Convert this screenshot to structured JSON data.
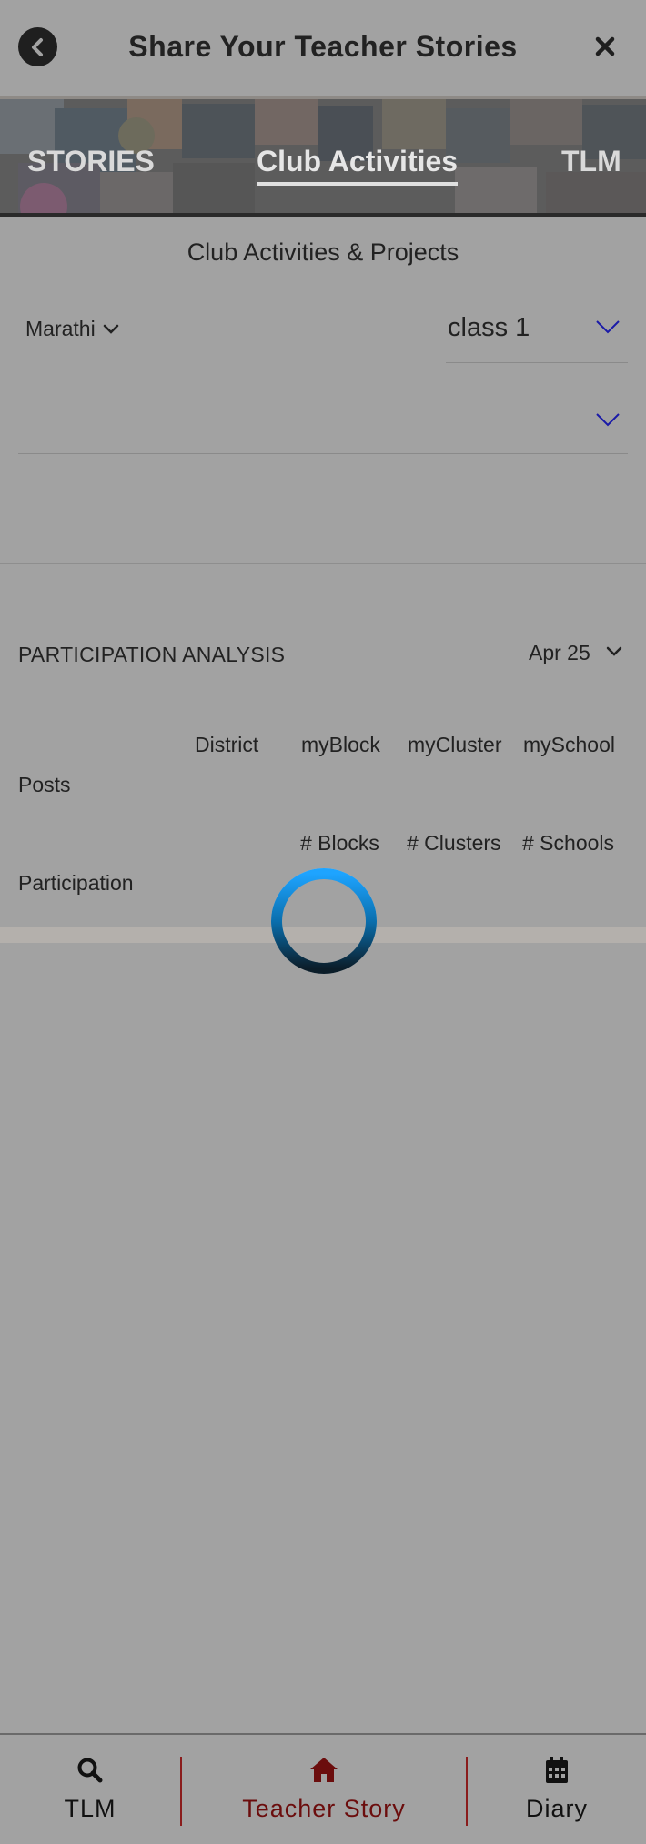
{
  "header": {
    "title": "Share Your Teacher Stories"
  },
  "banner": {
    "tabs": [
      {
        "label": "STORIES",
        "active": false
      },
      {
        "label": "Club Activities",
        "active": true
      },
      {
        "label": "TLM",
        "active": false
      }
    ]
  },
  "main": {
    "section_title": "Club Activities & Projects",
    "language_value": "Marathi",
    "class_value": "class 1",
    "second_select_value": ""
  },
  "analysis": {
    "title": "PARTICIPATION ANALYSIS",
    "month": "Apr 25",
    "columns_row1": [
      "District",
      "myBlock",
      "myCluster",
      "mySchool"
    ],
    "row1_label": "Posts",
    "columns_row2": [
      "# Blocks",
      "# Clusters",
      "# Schools"
    ],
    "row2_label": "Participation"
  },
  "bottom_nav": {
    "items": [
      {
        "label": "TLM",
        "icon": "search-icon"
      },
      {
        "label": "Teacher Story",
        "icon": "home-icon",
        "active": true
      },
      {
        "label": "Diary",
        "icon": "calendar-icon"
      }
    ]
  },
  "colors": {
    "overlay_bg": "#a2a2a2",
    "active_nav": "#6b0d0d",
    "chevron_blue": "#1a1aa8",
    "spinner_blue": "#1e9bff"
  }
}
